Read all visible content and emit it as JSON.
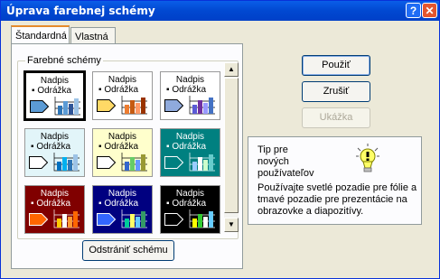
{
  "window": {
    "title": "Úprava farebnej schémy",
    "help_glyph": "?",
    "close_glyph": "✕"
  },
  "tabs": [
    {
      "label": "Štandardná"
    },
    {
      "label": "Vlastná"
    }
  ],
  "schemes": {
    "group_label": "Farebné schémy",
    "tile_title": "Nadpis",
    "tile_bullet": "▪ Odrážka",
    "tiles": [
      {
        "bg": "#ffffff",
        "text": "#000000",
        "arrow": "#5b9bd5",
        "bars": [
          "#2e75b6",
          "#5b9bd5",
          "#2f5597",
          "#9dc3e6"
        ],
        "selected": true
      },
      {
        "bg": "#ffffff",
        "text": "#000000",
        "arrow": "#ffd966",
        "bars": [
          "#ed7d31",
          "#c55a11",
          "#ff9966",
          "#993300"
        ],
        "selected": false
      },
      {
        "bg": "#ffffff",
        "text": "#000000",
        "arrow": "#8faadc",
        "bars": [
          "#5b5bd6",
          "#7030a0",
          "#9999ff",
          "#4472c4"
        ],
        "selected": false
      },
      {
        "bg": "#e2f5f9",
        "text": "#000000",
        "arrow": "#ffffff",
        "bars": [
          "#0070c0",
          "#00b0f0",
          "#2e75b6",
          "#9dc3e6"
        ],
        "selected": false
      },
      {
        "bg": "#ffffcc",
        "text": "#000000",
        "arrow": "#ffffff",
        "bars": [
          "#3366cc",
          "#66cc66",
          "#6699ff",
          "#999933"
        ],
        "selected": false
      },
      {
        "bg": "#008080",
        "text": "#ffffff",
        "arrow": "#008080",
        "bars": [
          "#99ccff",
          "#ffffff",
          "#ccffcc",
          "#66cccc"
        ],
        "selected": false
      },
      {
        "bg": "#800000",
        "text": "#ffffff",
        "arrow": "#ff6600",
        "bars": [
          "#ffcc00",
          "#ffffff",
          "#ff9933",
          "#ff6600"
        ],
        "selected": false
      },
      {
        "bg": "#000080",
        "text": "#ffffff",
        "arrow": "#3366ff",
        "bars": [
          "#00cc99",
          "#ffff66",
          "#66ccff",
          "#339966"
        ],
        "selected": false
      },
      {
        "bg": "#000000",
        "text": "#ffffff",
        "arrow": "#000000",
        "bars": [
          "#ffff00",
          "#33cc33",
          "#ffffff",
          "#66ccff"
        ],
        "selected": false
      }
    ]
  },
  "buttons": {
    "apply": "Použiť",
    "cancel": "Zrušiť",
    "preview": "Ukážka",
    "delete_scheme": "Odstrániť schému"
  },
  "tip": {
    "heading_lines": [
      "Tip pre",
      "nových",
      "používateľov"
    ],
    "body": "Používajte svetlé pozadie pre fólie a tmavé pozadie pre prezentácie na obrazovke a diapozitívy.",
    "icon": "lightbulb-icon"
  },
  "scrollbar": {
    "up_glyph": "▲",
    "down_glyph": "▼"
  }
}
